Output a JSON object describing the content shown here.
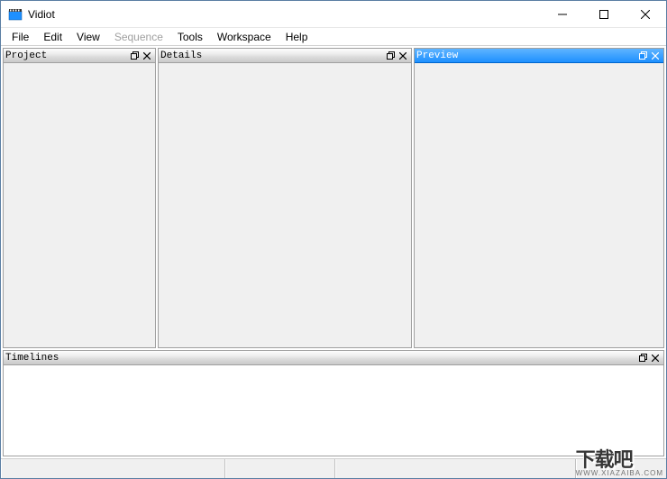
{
  "window": {
    "title": "Vidiot"
  },
  "menu": {
    "file": "File",
    "edit": "Edit",
    "view": "View",
    "sequence": "Sequence",
    "tools": "Tools",
    "workspace": "Workspace",
    "help": "Help"
  },
  "panels": {
    "project": "Project",
    "details": "Details",
    "preview": "Preview",
    "timelines": "Timelines"
  },
  "watermark": {
    "big": "下载吧",
    "small": "WWW.XIAZAIBA.COM"
  }
}
